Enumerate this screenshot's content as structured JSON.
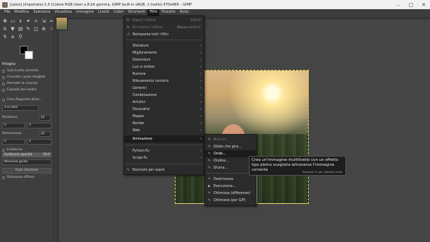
{
  "window": {
    "title": "[salvo] (importata)-1.0 (Colore RGB interi a 8 bit gamma, GIMP built-in sRGB, 1 livello) 470x469 – GIMP",
    "controls": [
      "–",
      "□",
      "✕"
    ]
  },
  "menubar": [
    "File",
    "Modifica",
    "Seleziona",
    "Visualizza",
    "Immagine",
    "Livello",
    "Colori",
    "Strumenti",
    "Filtri",
    "Finestre",
    "Aiuto"
  ],
  "active_menu": "Filtri",
  "toolbox": {
    "tool_icons": [
      "move-icon",
      "rect-select-icon",
      "lasso-icon",
      "fuzzy-select-icon",
      "crop-icon",
      "unified-transform-icon",
      "warp-icon",
      "text-icon",
      "bucket-fill-icon",
      "gradient-icon",
      "paintbrush-icon",
      "eraser-icon",
      "clone-icon",
      "smudge-icon",
      "path-icon",
      "color-picker-icon",
      "zoom-icon"
    ],
    "options": {
      "title": "Ritaglia",
      "checks": [
        "Solo livello corrente",
        "Cancella i pixel ritagliati",
        "Permetti la crescita",
        "Espandi dal centro",
        "Fisso Rapporto dime..."
      ],
      "ratio_value": "470:469",
      "position_label": "Posizione:",
      "position_unit": "px",
      "position_values": [
        "0",
        "0"
      ],
      "size_label": "Dimensione:",
      "size_unit": "px",
      "size_values": [
        "0",
        "0"
      ],
      "highlight_check": "Evidenzia",
      "opacity_label": "Evidenzia opacità",
      "opacity_value": "50.0",
      "guides_value": "Nessuna guida",
      "auto_shrink": "Auto riduzione",
      "shrink_merged": "Riduzione diffusa"
    }
  },
  "filters_menu": {
    "items": [
      {
        "label": "Ripeti l'ultimo",
        "shortcut": "Ctrl+F",
        "disabled": true
      },
      {
        "label": "Ri-mostra l'ultimo",
        "shortcut": "Maiusc+Ctrl+F",
        "disabled": true
      },
      {
        "label": "Reimposta tutti i filtri",
        "shortcut": "",
        "disabled": false
      },
      {
        "label": "Sfocature",
        "submenu": true
      },
      {
        "label": "Miglioramento",
        "submenu": true
      },
      {
        "label": "Distorsioni",
        "submenu": true
      },
      {
        "label": "Luci e ombre",
        "submenu": true
      },
      {
        "label": "Rumore",
        "submenu": true
      },
      {
        "label": "Rilevamento contorni",
        "submenu": true
      },
      {
        "label": "Generici",
        "submenu": true
      },
      {
        "label": "Combinazione",
        "submenu": true
      },
      {
        "label": "Artistici",
        "submenu": true
      },
      {
        "label": "Decorativi",
        "submenu": true
      },
      {
        "label": "Mappe",
        "submenu": true
      },
      {
        "label": "Render",
        "submenu": true
      },
      {
        "label": "Web",
        "submenu": true
      },
      {
        "label": "Animazione",
        "submenu": true,
        "highlighted": true
      },
      {
        "label": "Python-Fu",
        "submenu": true
      },
      {
        "label": "Script-Fu",
        "submenu": true
      },
      {
        "label": "Esercizio per ospre"
      }
    ]
  },
  "animation_submenu": {
    "items": [
      {
        "label": "Burn-In...",
        "disabled": true
      },
      {
        "label": "Globo che gira..."
      },
      {
        "label": "Onde...",
        "highlighted": true
      },
      {
        "label": "Ondine..."
      },
      {
        "label": "Sfuma..."
      },
      {
        "label": "Destrizzeza"
      },
      {
        "label": "Esecuzione..."
      },
      {
        "label": "Ottimizza (differenze)"
      },
      {
        "label": "Ottimizza (per GIF)"
      }
    ]
  },
  "tooltip": {
    "text": "Crea un'immagine multilivello con un effetto tipo pietra scagliata attraverso l'immagine corrente",
    "hint": "Premere F1 per ulteriore aiuto"
  }
}
